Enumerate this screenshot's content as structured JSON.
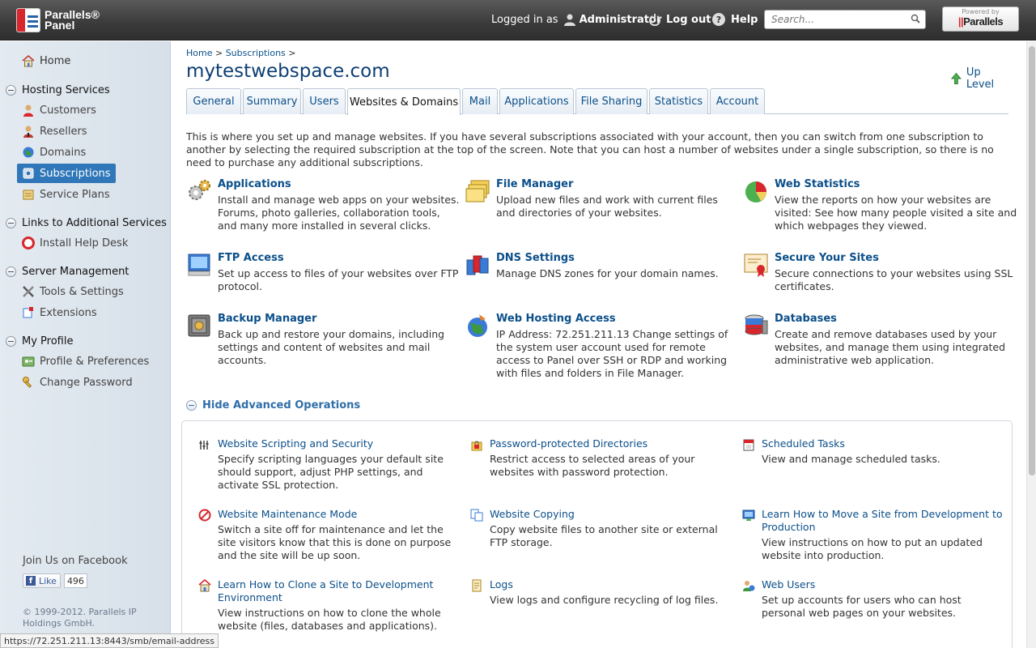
{
  "header": {
    "logo_line1": "Parallels®",
    "logo_line2": "Panel",
    "logged_in_label": "Logged in as",
    "user_name": "Administrator",
    "logout_label": "Log out",
    "help_label": "Help",
    "search_placeholder": "Search...",
    "powered_small": "Powered by",
    "powered_brand": "Parallels"
  },
  "sidebar": {
    "home": "Home",
    "groups": [
      {
        "label": "Hosting Services",
        "items": [
          "Customers",
          "Resellers",
          "Domains",
          "Subscriptions",
          "Service Plans"
        ]
      },
      {
        "label": "Links to Additional Services",
        "items": [
          "Install Help Desk"
        ]
      },
      {
        "label": "Server Management",
        "items": [
          "Tools & Settings",
          "Extensions"
        ]
      },
      {
        "label": "My Profile",
        "items": [
          "Profile & Preferences",
          "Change Password"
        ]
      }
    ],
    "active_item": "Subscriptions",
    "facebook_title": "Join Us on Facebook",
    "like_label": "Like",
    "like_count": "496",
    "copyright": "© 1999-2012. Parallels IP Holdings GmbH."
  },
  "breadcrumb": {
    "home": "Home",
    "sep": ">",
    "subscriptions": "Subscriptions"
  },
  "page_title": "mytestwebspace.com",
  "up_level": "Up Level",
  "tabs": [
    "General",
    "Summary",
    "Users",
    "Websites & Domains",
    "Mail",
    "Applications",
    "File Sharing",
    "Statistics",
    "Account"
  ],
  "active_tab": "Websites & Domains",
  "intro": "This is where you set up and manage websites. If you have several subscriptions associated with your account, then you can switch from one subscription to another by selecting the required subscription at the top of the screen. Note that you can host a number of websites under a single subscription, so there is no need to purchase any additional subscriptions.",
  "features": [
    {
      "title": "Applications",
      "desc": "Install and manage web apps on your websites. Forums, photo galleries, collaboration tools, and many more installed in several clicks."
    },
    {
      "title": "File Manager",
      "desc": "Upload new files and work with current files and directories of your websites."
    },
    {
      "title": "Web Statistics",
      "desc": "View the reports on how your websites are visited: See how many people visited a site and which webpages they viewed."
    },
    {
      "title": "FTP Access",
      "desc": "Set up access to files of your websites over FTP protocol."
    },
    {
      "title": "DNS Settings",
      "desc": "Manage DNS zones for your domain names."
    },
    {
      "title": "Secure Your Sites",
      "desc": "Secure connections to your websites using SSL certificates."
    },
    {
      "title": "Backup Manager",
      "desc": "Back up and restore your domains, including settings and content of websites and mail accounts."
    },
    {
      "title": "Web Hosting Access",
      "desc": "IP Address: 72.251.211.13 Change settings of the system user account used for remote access to Panel over SSH or RDP and working with files and folders in File Manager."
    },
    {
      "title": "Databases",
      "desc": "Create and remove databases used by your websites, and manage them using integrated administrative web application."
    }
  ],
  "advanced_toggle": "Hide Advanced Operations",
  "advanced": [
    {
      "title": "Website Scripting and Security",
      "desc": "Specify scripting languages your default site should support, adjust PHP settings, and activate SSL protection."
    },
    {
      "title": "Password-protected Directories",
      "desc": "Restrict access to selected areas of your websites with password protection."
    },
    {
      "title": "Scheduled Tasks",
      "desc": "View and manage scheduled tasks."
    },
    {
      "title": "Website Maintenance Mode",
      "desc": "Switch a site off for maintenance and let the site visitors know that this is done on purpose and the site will be up soon."
    },
    {
      "title": "Website Copying",
      "desc": "Copy website files to another site or external FTP storage."
    },
    {
      "title": "Learn How to Move a Site from Development to Production",
      "desc": "View instructions on how to put an updated website into production."
    },
    {
      "title": "Learn How to Clone a Site to Development Environment",
      "desc": "View instructions on how to clone the whole website (files, databases and applications)."
    },
    {
      "title": "Logs",
      "desc": "View logs and configure recycling of log files."
    },
    {
      "title": "Web Users",
      "desc": "Set up accounts for users who can host personal web pages on your websites."
    }
  ],
  "status_url": "https://72.251.211.13:8443/smb/email-address"
}
